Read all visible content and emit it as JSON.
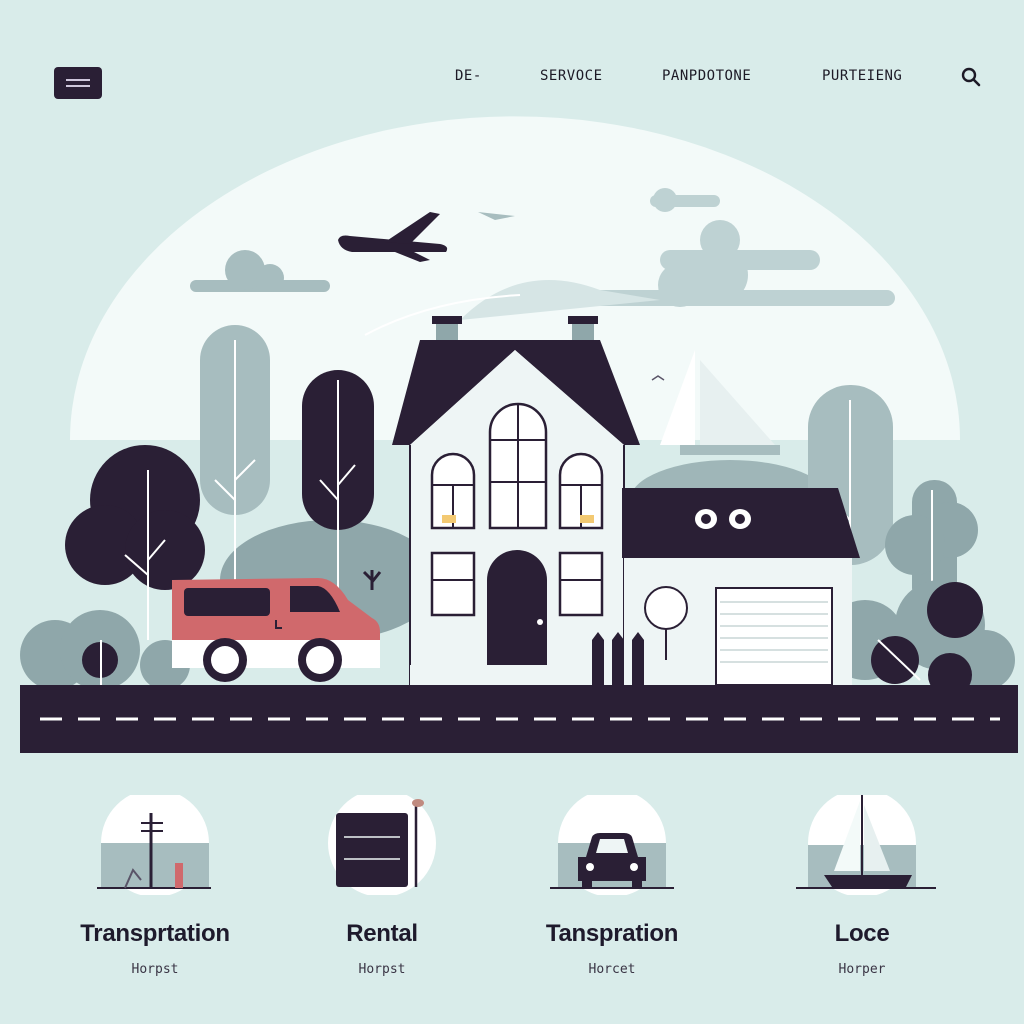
{
  "nav": {
    "links": [
      "DE-",
      "SERVOCE",
      "PANPDOTONE",
      "PURTEIENG"
    ]
  },
  "icons": {
    "menu": "hamburger-menu-icon",
    "search": "search-icon"
  },
  "colors": {
    "background": "#d9ecea",
    "dark": "#2a1f35",
    "van": "#d0696c",
    "tree": "#8fa7aa",
    "road_dash": "#ffffff"
  },
  "features": [
    {
      "title": "Transprtation",
      "subtitle": "Horpst",
      "icon": "power-pole-icon"
    },
    {
      "title": "Rental",
      "subtitle": "Horpst",
      "icon": "storage-unit-icon"
    },
    {
      "title": "Tanspration",
      "subtitle": "Horcet",
      "icon": "car-icon"
    },
    {
      "title": "Loce",
      "subtitle": "Horper",
      "icon": "sailboat-icon"
    }
  ]
}
